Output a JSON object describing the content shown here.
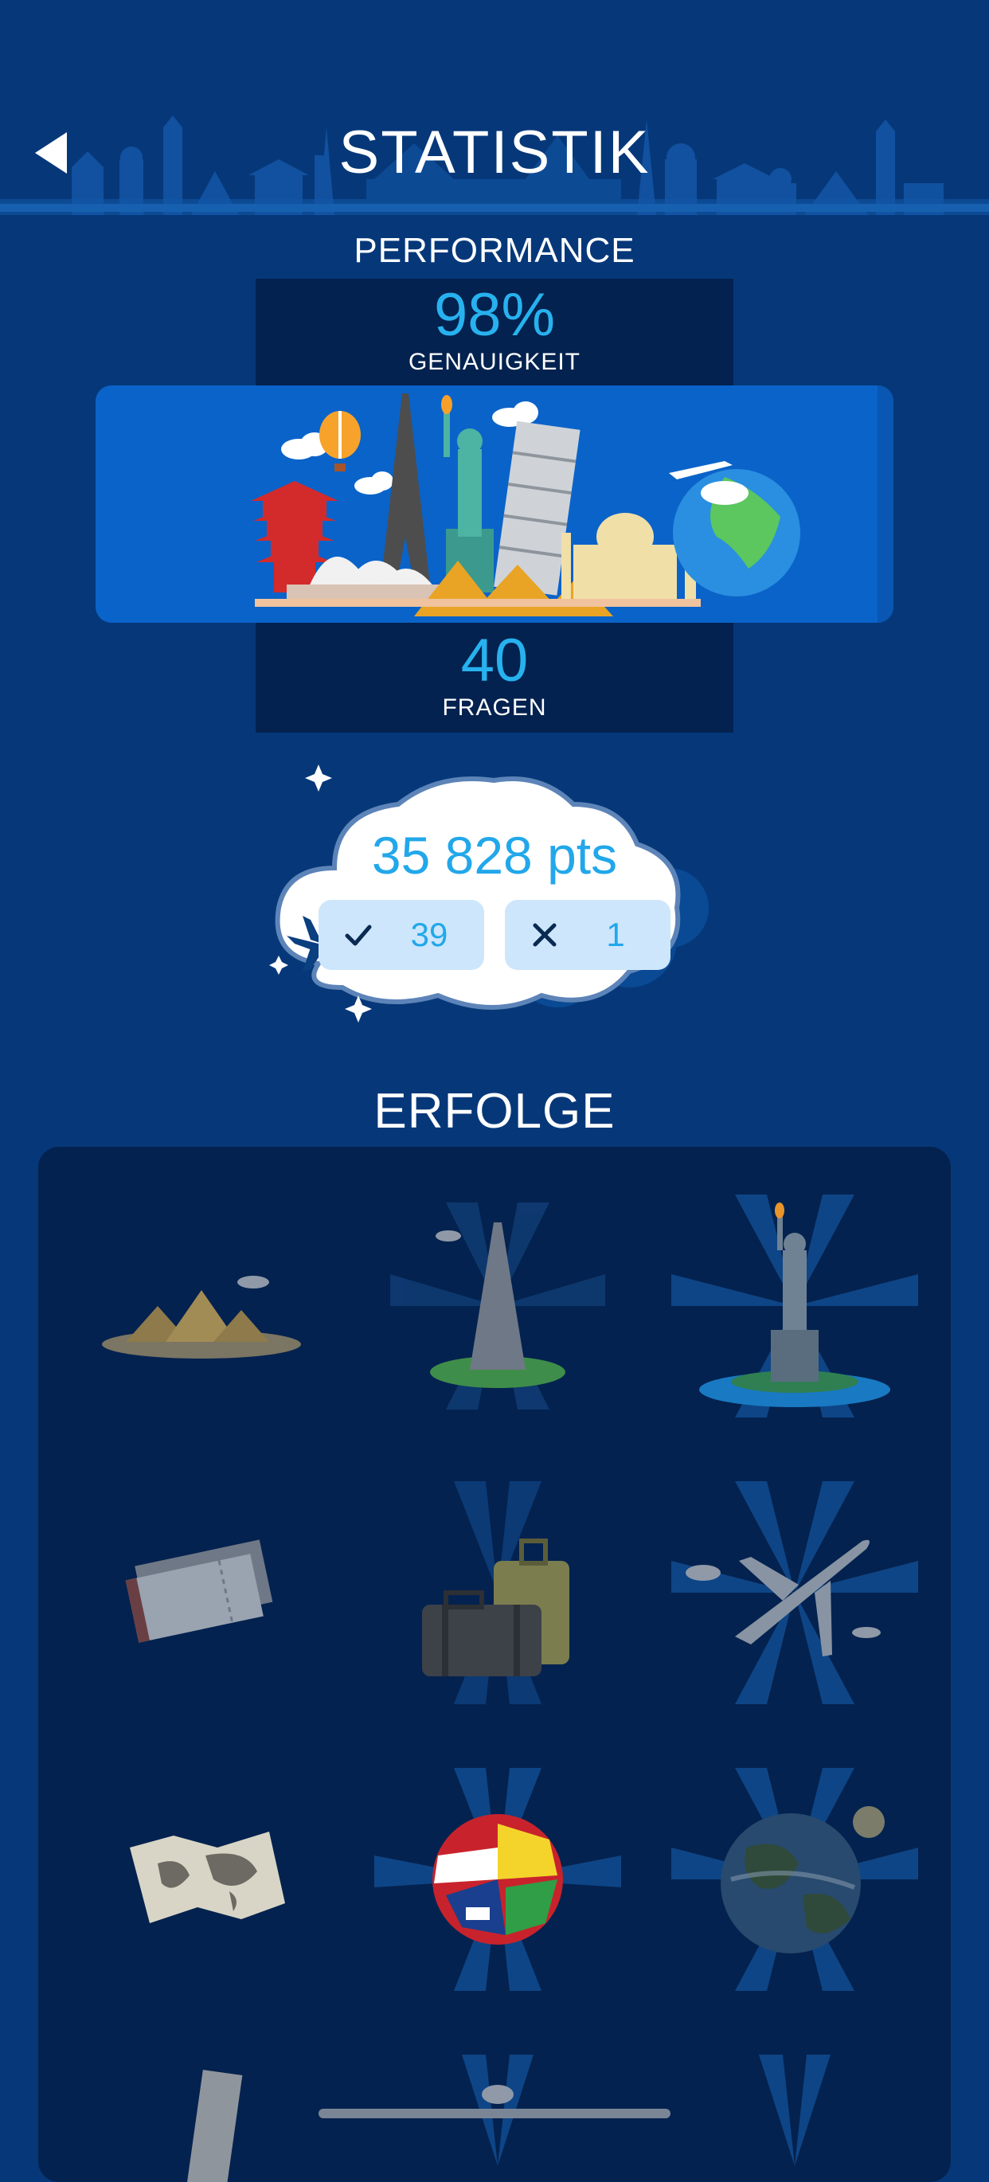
{
  "header": {
    "title": "STATISTIK",
    "back_icon": "back-arrow-icon"
  },
  "performance": {
    "title": "PERFORMANCE",
    "accuracy_value": "98%",
    "accuracy_label": "GENAUIGKEIT",
    "questions_value": "40",
    "questions_label": "FRAGEN"
  },
  "score": {
    "points": "35 828 pts",
    "correct_count": "39",
    "wrong_count": "1",
    "correct_icon": "checkmark-icon",
    "wrong_icon": "cross-icon"
  },
  "achievements": {
    "title": "ERFOLGE",
    "items": [
      {
        "name": "pyramids",
        "unlocked": false
      },
      {
        "name": "eiffel-tower",
        "unlocked": true
      },
      {
        "name": "statue-of-liberty",
        "unlocked": true
      },
      {
        "name": "tickets",
        "unlocked": false
      },
      {
        "name": "suitcases",
        "unlocked": false
      },
      {
        "name": "airplane",
        "unlocked": true
      },
      {
        "name": "world-map",
        "unlocked": false
      },
      {
        "name": "flag-globe",
        "unlocked": true
      },
      {
        "name": "earth",
        "unlocked": true
      }
    ]
  },
  "colors": {
    "background": "#063879",
    "accent": "#27b2ef",
    "dark_panel": "#04224f",
    "banner": "#0a63c9"
  }
}
